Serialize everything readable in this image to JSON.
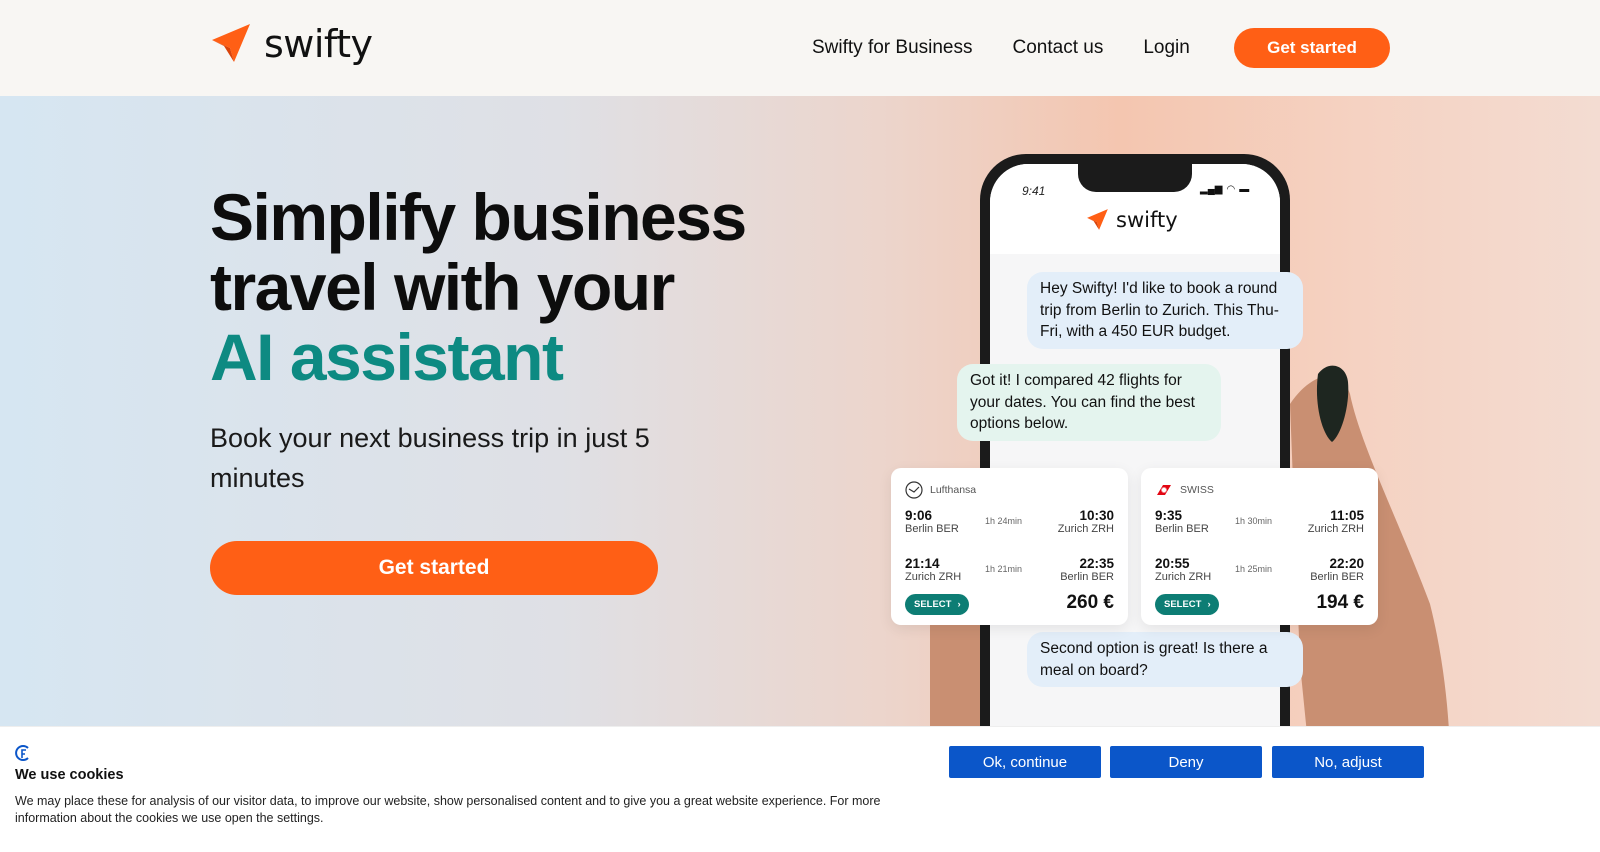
{
  "brand": {
    "name": "swifty",
    "accent_color": "#ff5f15",
    "accent_teal": "#0d8a82"
  },
  "header": {
    "nav": [
      {
        "label": "Swifty for Business"
      },
      {
        "label": "Contact us"
      },
      {
        "label": "Login"
      }
    ],
    "cta_label": "Get started"
  },
  "hero": {
    "title_line1": "Simplify business",
    "title_line2": "travel with your",
    "title_accent": "AI assistant",
    "subtitle": "Book your next business trip in just 5 minutes",
    "cta_label": "Get started"
  },
  "phone": {
    "time": "9:41",
    "app_name": "swifty",
    "messages": [
      {
        "role": "user",
        "text": "Hey Swifty! I'd like to book a round trip from Berlin to Zurich. This Thu-Fri, with a 450 EUR budget."
      },
      {
        "role": "bot",
        "text": "Got it! I compared 42 flights for your dates. You can find the best options below."
      },
      {
        "role": "user",
        "text": "Second option is great! Is there a meal on board?"
      }
    ],
    "flights": [
      {
        "airline": "Lufthansa",
        "outbound": {
          "dep_time": "9:06",
          "dep_airport": "Berlin BER",
          "duration": "1h 24min",
          "arr_time": "10:30",
          "arr_airport": "Zurich ZRH"
        },
        "return": {
          "dep_time": "21:14",
          "dep_airport": "Zurich ZRH",
          "duration": "1h 21min",
          "arr_time": "22:35",
          "arr_airport": "Berlin BER"
        },
        "select_label": "SELECT",
        "price": "260 €"
      },
      {
        "airline": "SWISS",
        "outbound": {
          "dep_time": "9:35",
          "dep_airport": "Berlin BER",
          "duration": "1h 30min",
          "arr_time": "11:05",
          "arr_airport": "Zurich ZRH"
        },
        "return": {
          "dep_time": "20:55",
          "dep_airport": "Zurich ZRH",
          "duration": "1h 25min",
          "arr_time": "22:20",
          "arr_airport": "Berlin BER"
        },
        "select_label": "SELECT",
        "price": "194 €"
      }
    ]
  },
  "cookie": {
    "title": "We use cookies",
    "text": "We may place these for analysis of our visitor data, to improve our website, show personalised content and to give you a great website experience. For more information about the cookies we use open the settings.",
    "buttons": [
      {
        "label": "Ok, continue"
      },
      {
        "label": "Deny"
      },
      {
        "label": "No, adjust"
      }
    ],
    "button_color": "#0b56c9"
  }
}
